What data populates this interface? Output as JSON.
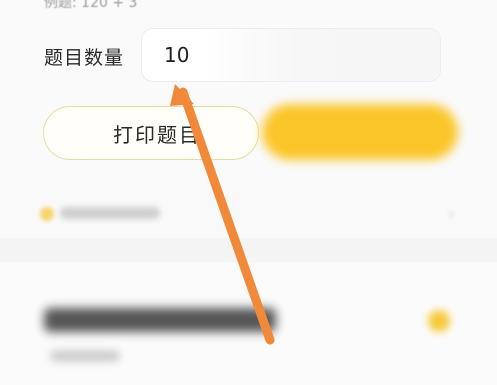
{
  "settings": {
    "example_text": "例题: 120 + 3",
    "count_label": "题目数量",
    "count_value": "10"
  },
  "actions": {
    "print_label": "打印题目",
    "primary_label": ""
  },
  "annotation": {
    "arrow_color": "#f08a3a"
  },
  "colors": {
    "accent_yellow": "#fbc62a",
    "outline_yellow": "#e8dca6"
  }
}
